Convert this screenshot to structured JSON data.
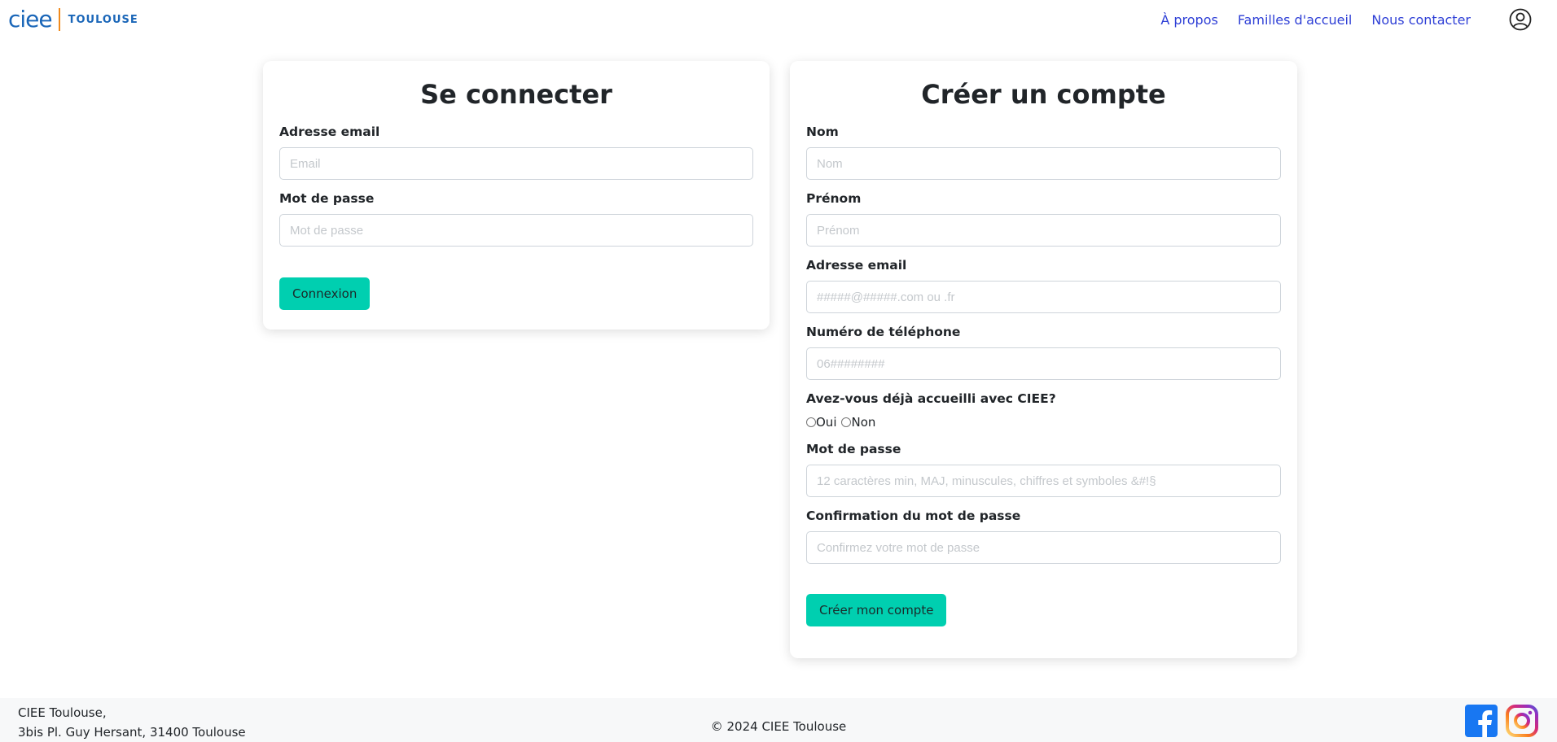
{
  "header": {
    "logo_text": "ciee",
    "logo_city": "TOULOUSE",
    "nav": [
      {
        "label": "À propos"
      },
      {
        "label": "Familles d'accueil"
      },
      {
        "label": "Nous contacter"
      }
    ]
  },
  "login": {
    "title": "Se connecter",
    "email_label": "Adresse email",
    "email_placeholder": "Email",
    "email_value": "",
    "password_label": "Mot de passe",
    "password_placeholder": "Mot de passe",
    "password_value": "",
    "submit_label": "Connexion"
  },
  "signup": {
    "title": "Créer un compte",
    "nom_label": "Nom",
    "nom_placeholder": "Nom",
    "prenom_label": "Prénom",
    "prenom_placeholder": "Prénom",
    "email_label": "Adresse email",
    "email_placeholder": "#####@#####.com ou .fr",
    "phone_label": "Numéro de téléphone",
    "phone_placeholder": "06########",
    "hosted_question": "Avez-vous déjà accueilli avec CIEE?",
    "hosted_options": [
      "Oui",
      "Non"
    ],
    "hosted_selected": "",
    "password_label": "Mot de passe",
    "password_placeholder": "12 caractères min, MAJ, minuscules, chiffres et symboles &#!§",
    "confirm_label": "Confirmation du mot de passe",
    "confirm_placeholder": "Confirmez votre mot de passe",
    "submit_label": "Créer mon compte"
  },
  "footer": {
    "address_line1": "CIEE Toulouse,",
    "address_line2": "3bis Pl. Guy Hersant, 31400 Toulouse",
    "copyright": "© 2024 CIEE Toulouse"
  },
  "colors": {
    "accent": "#00cfb0",
    "nav_link": "#2e3fd6",
    "brand_blue": "#1a66b8",
    "brand_orange": "#f08a1c"
  },
  "icons": {
    "user": "user-circle-icon",
    "facebook": "facebook-icon",
    "instagram": "instagram-icon"
  }
}
